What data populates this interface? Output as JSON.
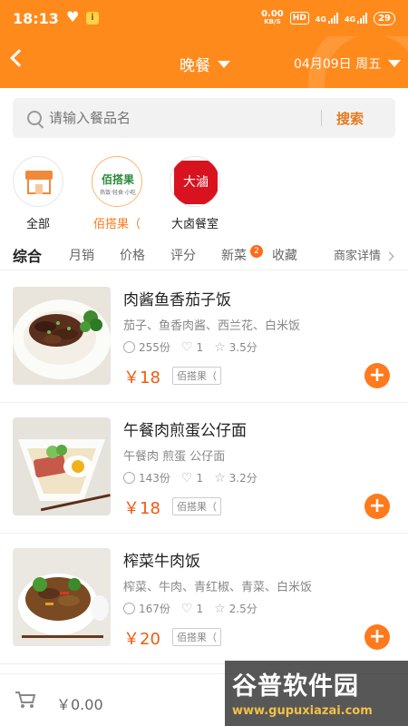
{
  "status_bar": {
    "time": "18:13",
    "network_speed": "0.00",
    "network_unit": "KB/S",
    "hd": "HD",
    "signal1": "4G",
    "signal2": "4G",
    "battery": "29"
  },
  "header": {
    "back_icon": "chevron-left-icon",
    "meal": "晚餐",
    "date": "04月09日 周五"
  },
  "search": {
    "placeholder": "请输入餐品名",
    "button": "搜索"
  },
  "shops": [
    {
      "name": "全部",
      "logo_text": ""
    },
    {
      "name": "佰搭果（",
      "logo_text": "佰搭果",
      "logo_sub": "热饭·轻食·小吃"
    },
    {
      "name": "大卤餐室",
      "logo_text": "大滷"
    }
  ],
  "tabs": [
    {
      "label": "综合"
    },
    {
      "label": "月销"
    },
    {
      "label": "价格"
    },
    {
      "label": "评分"
    },
    {
      "label": "新菜",
      "badge": "2"
    },
    {
      "label": "收藏"
    },
    {
      "label": "商家详情"
    }
  ],
  "items": [
    {
      "title": "肉酱鱼香茄子饭",
      "desc": "茄子、鱼香肉酱、西兰花、白米饭",
      "sales": "255份",
      "likes": "1",
      "rating": "3.5分",
      "price": "￥18",
      "shop_tag": "佰搭果（"
    },
    {
      "title": "午餐肉煎蛋公仔面",
      "desc": "午餐肉 煎蛋 公仔面",
      "sales": "143份",
      "likes": "1",
      "rating": "3.2分",
      "price": "￥18",
      "shop_tag": "佰搭果（"
    },
    {
      "title": "榨菜牛肉饭",
      "desc": "榨菜、牛肉、青红椒、青菜、白米饭",
      "sales": "167份",
      "likes": "1",
      "rating": "2.5分",
      "price": "￥20",
      "shop_tag": "佰搭果（"
    }
  ],
  "cart": {
    "total": "￥0.00"
  },
  "watermark": {
    "title": "谷普软件园",
    "url": "www.gupuxiazai.com"
  },
  "colors": {
    "brand": "#ff8a1c",
    "price": "#f25a0f"
  }
}
